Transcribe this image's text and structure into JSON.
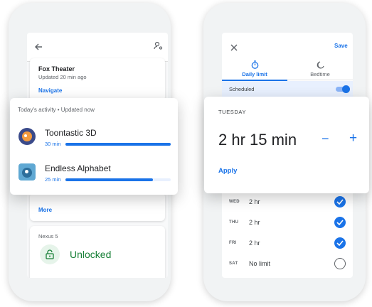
{
  "left_phone": {
    "location_card": {
      "title": "Fox Theater",
      "updated": "Updated 20 min ago",
      "navigate": "Navigate"
    },
    "more_link": "More",
    "device_card": {
      "device": "Nexus 5",
      "status": "Unlocked"
    }
  },
  "activity": {
    "header": "Today's activity • Updated now",
    "apps": [
      {
        "name": "Toontastic 3D",
        "time": "30 min",
        "fraction": 1.0
      },
      {
        "name": "Endless Alphabet",
        "time": "25 min",
        "fraction": 0.83
      }
    ]
  },
  "right_phone": {
    "save": "Save",
    "tabs": [
      {
        "label": "Daily limit",
        "active": true
      },
      {
        "label": "Bedtime",
        "active": false
      }
    ],
    "scheduled_label": "Scheduled",
    "scheduled_on": true,
    "days": [
      {
        "abbr": "WED",
        "value": "2 hr",
        "checked": true
      },
      {
        "abbr": "THU",
        "value": "2 hr",
        "checked": true
      },
      {
        "abbr": "FRI",
        "value": "2 hr",
        "checked": true
      },
      {
        "abbr": "SAT",
        "value": "No limit",
        "checked": false
      }
    ]
  },
  "limit": {
    "day": "TUESDAY",
    "time": "2 hr 15 min",
    "minus": "−",
    "plus": "+",
    "apply": "Apply"
  },
  "colors": {
    "accent": "#1a73e8",
    "success": "#188038"
  }
}
